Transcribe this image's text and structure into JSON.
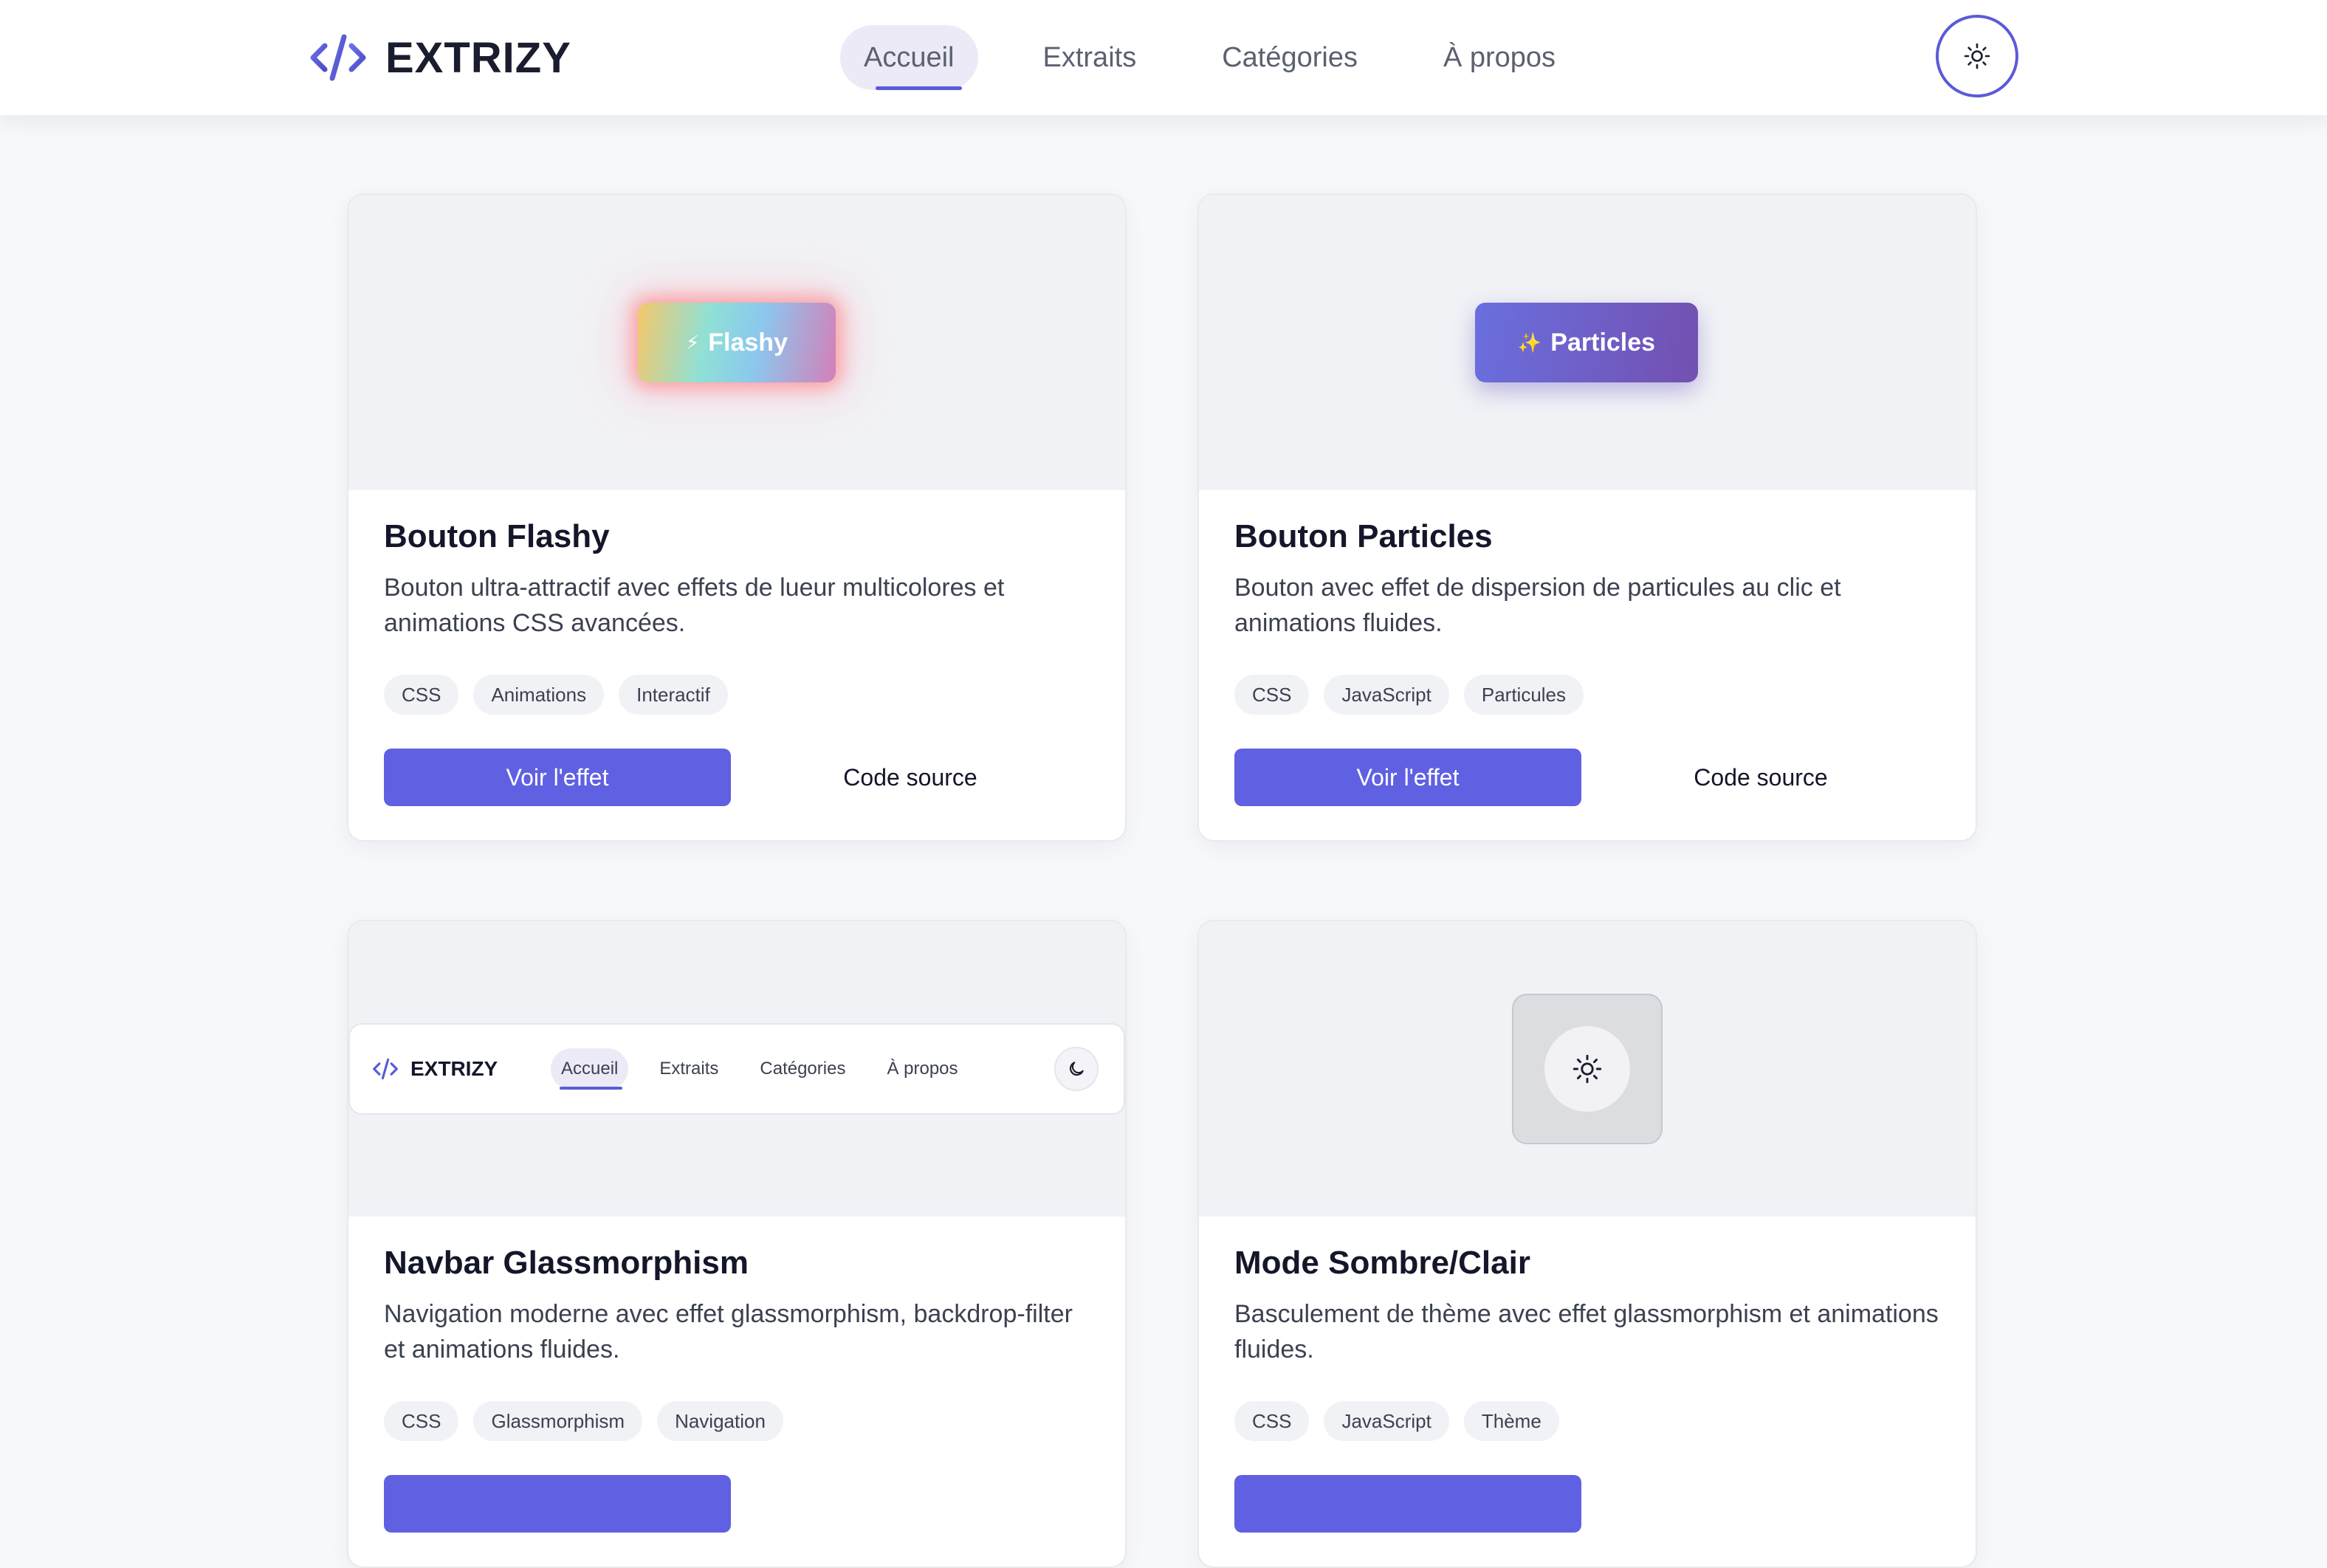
{
  "nav": {
    "brand": "EXTRIZY",
    "links": [
      {
        "label": "Accueil"
      },
      {
        "label": "Extraits"
      },
      {
        "label": "Catégories"
      },
      {
        "label": "À propos"
      }
    ],
    "theme_icon": "sun-icon"
  },
  "colors": {
    "accent": "#5b5bd6",
    "primary_button": "#6060e2",
    "page_bg": "#f7f8fa"
  },
  "cards": [
    {
      "demo_label": "Flashy",
      "demo_icon": "⚡",
      "title": "Bouton Flashy",
      "description": "Bouton ultra-attractif avec effets de lueur multicolores et animations CSS avancées.",
      "tags": [
        "CSS",
        "Animations",
        "Interactif"
      ],
      "primary": "Voir l'effet",
      "secondary": "Code source"
    },
    {
      "demo_label": "Particles",
      "demo_icon": "✨",
      "title": "Bouton Particles",
      "description": "Bouton avec effet de dispersion de particules au clic et animations fluides.",
      "tags": [
        "CSS",
        "JavaScript",
        "Particules"
      ],
      "primary": "Voir l'effet",
      "secondary": "Code source"
    },
    {
      "demo_nav": {
        "brand": "EXTRIZY",
        "links": [
          "Accueil",
          "Extraits",
          "Catégories",
          "À propos"
        ],
        "theme_icon": "moon-icon"
      },
      "title": "Navbar Glassmorphism",
      "description": "Navigation moderne avec effet glassmorphism, backdrop-filter et animations fluides.",
      "tags": [
        "CSS",
        "Glassmorphism",
        "Navigation"
      ]
    },
    {
      "demo_icon": "sun-icon",
      "title": "Mode Sombre/Clair",
      "description": "Basculement de thème avec effet glassmorphism et animations fluides.",
      "tags": [
        "CSS",
        "JavaScript",
        "Thème"
      ]
    }
  ]
}
